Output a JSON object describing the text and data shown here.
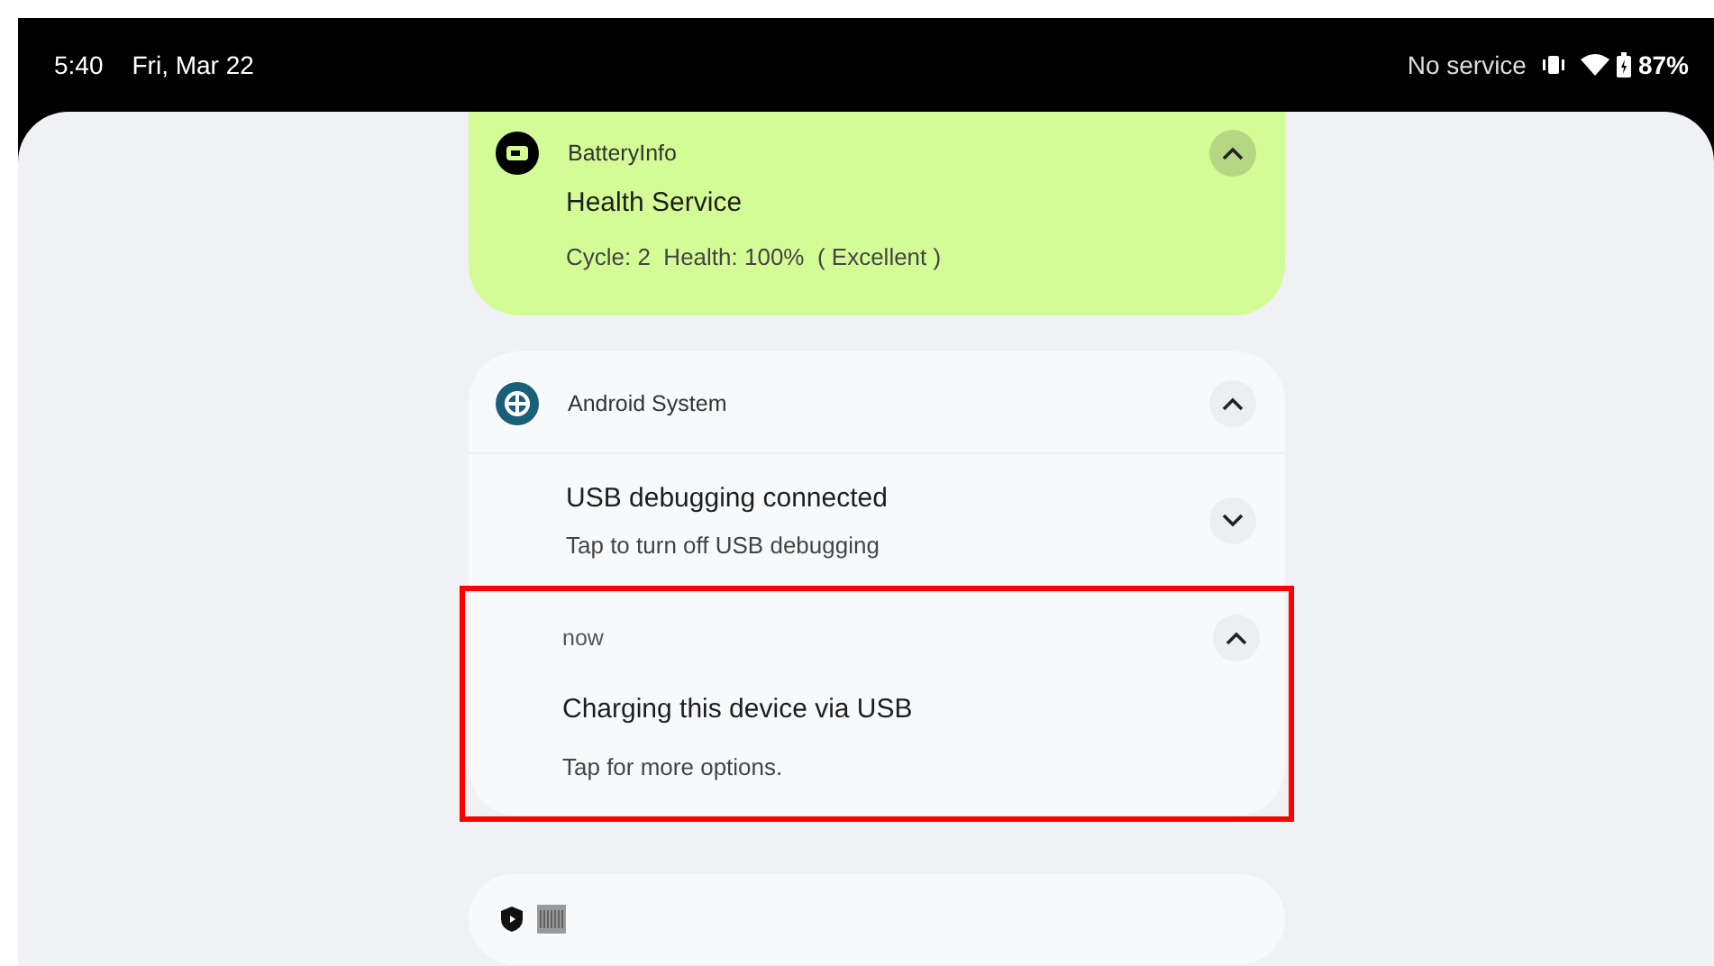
{
  "status_bar": {
    "time": "5:40",
    "date": "Fri, Mar 22",
    "carrier": "No service",
    "battery": "87%"
  },
  "notifications": [
    {
      "kind": "single",
      "color": "#d4fc96",
      "app": "BatteryInfo",
      "title": "Health Service",
      "text": "Cycle: 2  Health: 100%  ( Excellent )",
      "expanded": true
    },
    {
      "kind": "group",
      "app": "Android System",
      "expanded": true,
      "children": [
        {
          "title": "USB debugging connected",
          "text": "Tap to turn off USB debugging",
          "expanded": false,
          "highlighted": false
        },
        {
          "time": "now",
          "title": "Charging this device via USB",
          "text": "Tap for more options.",
          "expanded": true,
          "highlighted": true
        }
      ]
    },
    {
      "kind": "icon_shelf"
    }
  ]
}
